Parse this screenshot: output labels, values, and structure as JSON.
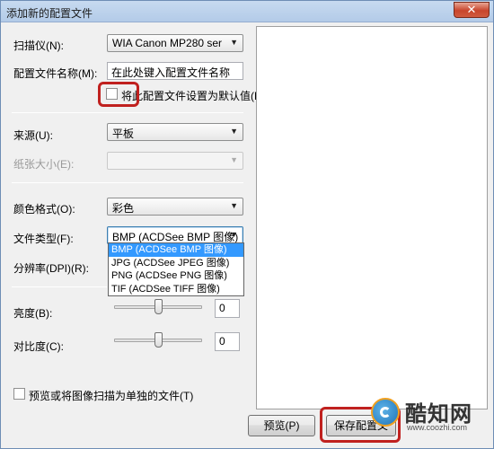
{
  "window": {
    "title": "添加新的配置文件",
    "close_symbol": "✕"
  },
  "form": {
    "scanner_label": "扫描仪(N):",
    "scanner_value": "WIA Canon MP280 ser",
    "profile_name_label": "配置文件名称(M):",
    "profile_name_value": "在此处键入配置文件名称",
    "default_checkbox_label": "将此配置文件设置为默认值(L)",
    "default_checked": false,
    "source_label": "来源(U):",
    "source_value": "平板",
    "paper_size_label": "纸张大小(E):",
    "paper_size_value": "",
    "color_format_label": "颜色格式(O):",
    "color_format_value": "彩色",
    "file_type_label": "文件类型(F):",
    "file_type_value": "BMP (ACDSee BMP 图像)",
    "file_type_options": [
      "BMP (ACDSee BMP 图像)",
      "JPG (ACDSee JPEG 图像)",
      "PNG (ACDSee PNG 图像)",
      "TIF (ACDSee TIFF 图像)"
    ],
    "resolution_label": "分辨率(DPI)(R):",
    "brightness_label": "亮度(B):",
    "brightness_value": "0",
    "contrast_label": "对比度(C):",
    "contrast_value": "0",
    "separate_files_label": "预览或将图像扫描为单独的文件(T)",
    "separate_files_checked": false
  },
  "buttons": {
    "preview": "预览(P)",
    "save_profile": "保存配置文"
  },
  "watermark": {
    "brand": "酷知网",
    "url": "www.coozhi.com"
  },
  "colors": {
    "highlight": "#c0211f",
    "selection": "#3399ff"
  }
}
